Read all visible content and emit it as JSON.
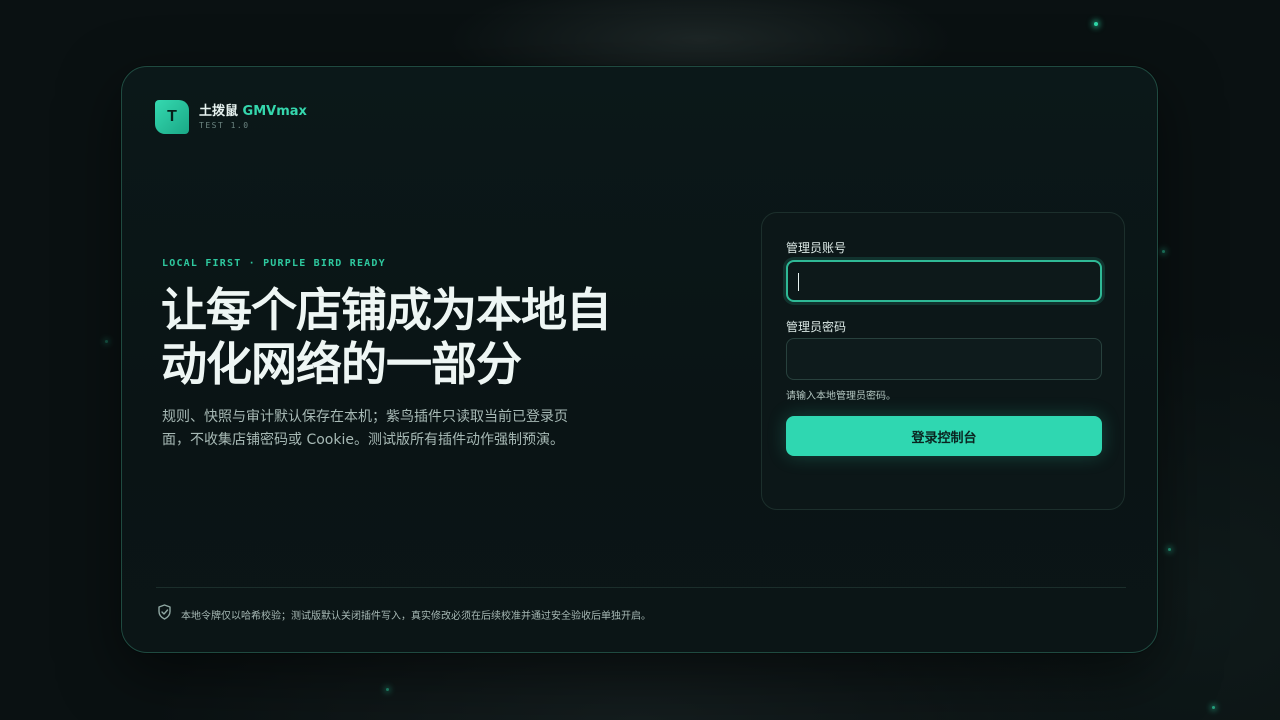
{
  "brand": {
    "logo_letter": "T",
    "name": "土拨鼠",
    "product": "GMVmax",
    "version": "TEST 1.0"
  },
  "hero": {
    "eyebrow": "LOCAL FIRST · PURPLE BIRD READY",
    "headline_line1": "让每个店铺成为本地自",
    "headline_line2": "动化网络的一部分",
    "desc_line1": "规则、快照与审计默认保存在本机；紫鸟插件只读取当前已登录页",
    "desc_line2": "面，不收集店铺密码或 Cookie。测试版所有插件动作强制预演。"
  },
  "login": {
    "account_label": "管理员账号",
    "account_value": "",
    "password_label": "管理员密码",
    "password_value": "",
    "hint": "请输入本地管理员密码。",
    "submit_label": "登录控制台"
  },
  "footer": {
    "icon": "shield-check-icon",
    "text": "本地令牌仅以哈希校验；测试版默认关闭插件写入，真实修改必须在后续校准并通过安全验收后单独开启。"
  },
  "colors": {
    "accent": "#2fd7b1",
    "background": "#0a1112",
    "card_border": "#1f4a40"
  }
}
